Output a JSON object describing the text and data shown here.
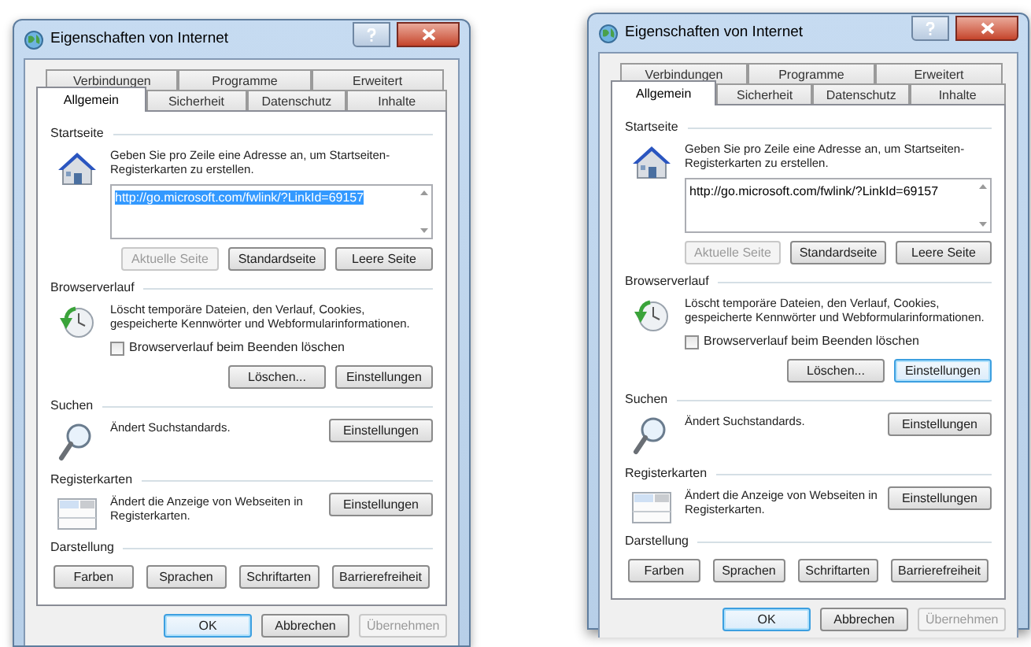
{
  "dialogs": [
    {
      "title": "Eigenschaften von Internet",
      "tab_rows": [
        [
          {
            "label": "Verbindungen",
            "selected": false
          },
          {
            "label": "Programme",
            "selected": false
          },
          {
            "label": "Erweitert",
            "selected": false
          }
        ],
        [
          {
            "label": "Allgemein",
            "selected": true
          },
          {
            "label": "Sicherheit",
            "selected": false
          },
          {
            "label": "Datenschutz",
            "selected": false
          },
          {
            "label": "Inhalte",
            "selected": false
          }
        ]
      ],
      "sections": [
        {
          "kind": "home",
          "heading": "Startseite",
          "description": "Geben Sie pro Zeile eine Adresse an, um Startseiten-Registerkarten zu erstellen.",
          "url_field": {
            "value": "http://go.microsoft.com/fwlink/?LinkId=69157",
            "selected": true
          },
          "buttons": [
            {
              "label": "Aktuelle Seite",
              "disabled": true,
              "focused": false
            },
            {
              "label": "Standardseite",
              "disabled": false,
              "focused": false
            },
            {
              "label": "Leere Seite",
              "disabled": false,
              "focused": false
            }
          ]
        },
        {
          "kind": "history",
          "heading": "Browserverlauf",
          "description": "Löscht temporäre Dateien, den Verlauf, Cookies, gespeicherte Kennwörter und Webformularinformationen.",
          "checkbox": {
            "label": "Browserverlauf beim Beenden löschen",
            "checked": false
          },
          "buttons": [
            {
              "label": "Löschen...",
              "disabled": false,
              "focused": false
            },
            {
              "label": "Einstellungen",
              "disabled": false,
              "focused": false
            }
          ]
        },
        {
          "kind": "search",
          "heading": "Suchen",
          "description": "Ändert Suchstandards.",
          "buttons": [
            {
              "label": "Einstellungen",
              "disabled": false,
              "focused": false
            }
          ]
        },
        {
          "kind": "tabs",
          "heading": "Registerkarten",
          "description": "Ändert die Anzeige von Webseiten in Registerkarten.",
          "buttons": [
            {
              "label": "Einstellungen",
              "disabled": false,
              "focused": false
            }
          ]
        },
        {
          "kind": "appearance",
          "heading": "Darstellung",
          "buttons": [
            {
              "label": "Farben",
              "disabled": false,
              "focused": false
            },
            {
              "label": "Sprachen",
              "disabled": false,
              "focused": false
            },
            {
              "label": "Schriftarten",
              "disabled": false,
              "focused": false
            },
            {
              "label": "Barrierefreiheit",
              "disabled": false,
              "focused": false
            }
          ]
        }
      ],
      "footer_buttons": [
        {
          "label": "OK",
          "disabled": false,
          "focused": true
        },
        {
          "label": "Abbrechen",
          "disabled": false,
          "focused": false
        },
        {
          "label": "Übernehmen",
          "disabled": true,
          "focused": false
        }
      ]
    },
    {
      "title": "Eigenschaften von Internet",
      "tab_rows": [
        [
          {
            "label": "Verbindungen",
            "selected": false
          },
          {
            "label": "Programme",
            "selected": false
          },
          {
            "label": "Erweitert",
            "selected": false
          }
        ],
        [
          {
            "label": "Allgemein",
            "selected": true
          },
          {
            "label": "Sicherheit",
            "selected": false
          },
          {
            "label": "Datenschutz",
            "selected": false
          },
          {
            "label": "Inhalte",
            "selected": false
          }
        ]
      ],
      "sections": [
        {
          "kind": "home",
          "heading": "Startseite",
          "description": "Geben Sie pro Zeile eine Adresse an, um Startseiten-Registerkarten zu erstellen.",
          "url_field": {
            "value": "http://go.microsoft.com/fwlink/?LinkId=69157",
            "selected": false
          },
          "buttons": [
            {
              "label": "Aktuelle Seite",
              "disabled": true,
              "focused": false
            },
            {
              "label": "Standardseite",
              "disabled": false,
              "focused": false
            },
            {
              "label": "Leere Seite",
              "disabled": false,
              "focused": false
            }
          ]
        },
        {
          "kind": "history",
          "heading": "Browserverlauf",
          "description": "Löscht temporäre Dateien, den Verlauf, Cookies, gespeicherte Kennwörter und Webformularinformationen.",
          "checkbox": {
            "label": "Browserverlauf beim Beenden löschen",
            "checked": false
          },
          "buttons": [
            {
              "label": "Löschen...",
              "disabled": false,
              "focused": false
            },
            {
              "label": "Einstellungen",
              "disabled": false,
              "focused": true
            }
          ]
        },
        {
          "kind": "search",
          "heading": "Suchen",
          "description": "Ändert Suchstandards.",
          "buttons": [
            {
              "label": "Einstellungen",
              "disabled": false,
              "focused": false
            }
          ]
        },
        {
          "kind": "tabs",
          "heading": "Registerkarten",
          "description": "Ändert die Anzeige von Webseiten in Registerkarten.",
          "buttons": [
            {
              "label": "Einstellungen",
              "disabled": false,
              "focused": false
            }
          ]
        },
        {
          "kind": "appearance",
          "heading": "Darstellung",
          "buttons": [
            {
              "label": "Farben",
              "disabled": false,
              "focused": false
            },
            {
              "label": "Sprachen",
              "disabled": false,
              "focused": false
            },
            {
              "label": "Schriftarten",
              "disabled": false,
              "focused": false
            },
            {
              "label": "Barrierefreiheit",
              "disabled": false,
              "focused": false
            }
          ]
        }
      ],
      "footer_buttons": [
        {
          "label": "OK",
          "disabled": false,
          "focused": true
        },
        {
          "label": "Abbrechen",
          "disabled": false,
          "focused": false
        },
        {
          "label": "Übernehmen",
          "disabled": true,
          "focused": false
        }
      ]
    }
  ]
}
